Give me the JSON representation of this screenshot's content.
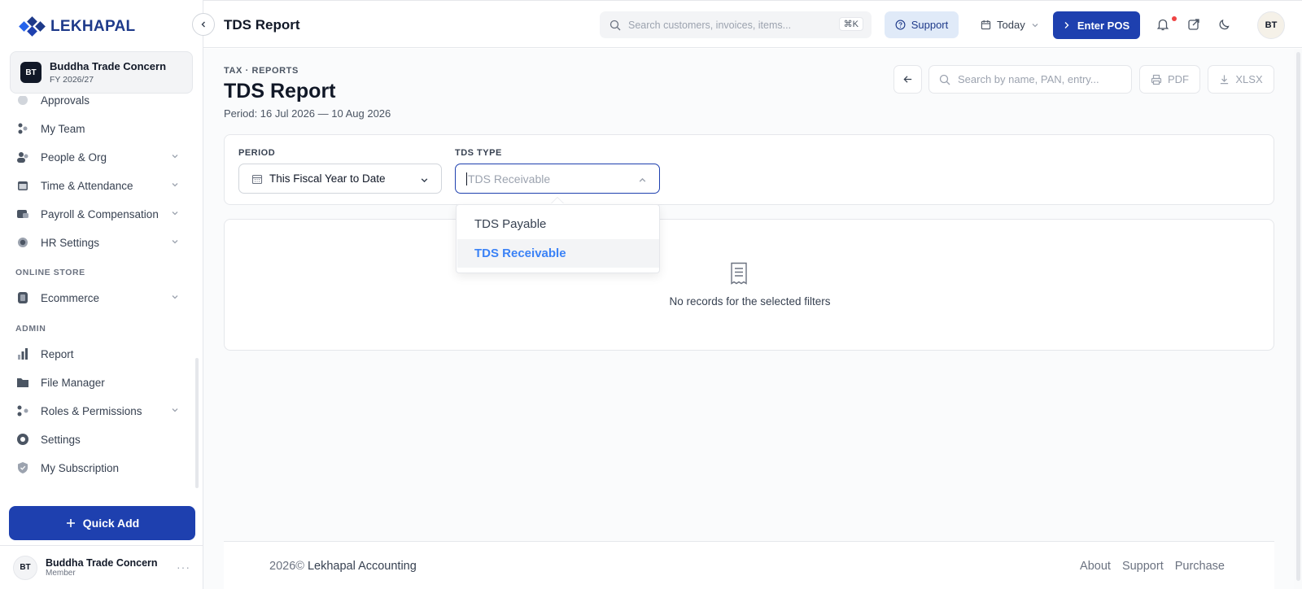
{
  "brand": {
    "name": "LEKHAPAL"
  },
  "org": {
    "initials": "BT",
    "name": "Buddha Trade Concern",
    "fy": "FY 2026/27"
  },
  "sidebar": {
    "items": [
      {
        "label": "Approvals",
        "icon": "approvals-icon"
      },
      {
        "label": "My Team",
        "icon": "team-icon"
      },
      {
        "label": "People & Org",
        "icon": "people-icon",
        "has_children": true
      },
      {
        "label": "Time & Attendance",
        "icon": "calendar-icon",
        "has_children": true
      },
      {
        "label": "Payroll & Compensation",
        "icon": "payroll-icon",
        "has_children": true
      },
      {
        "label": "HR Settings",
        "icon": "gear-icon",
        "has_children": true
      }
    ],
    "section_online_store": "ONLINE STORE",
    "online_store_items": [
      {
        "label": "Ecommerce",
        "icon": "store-icon",
        "has_children": true
      }
    ],
    "section_admin": "ADMIN",
    "admin_items": [
      {
        "label": "Report",
        "icon": "bar-chart-icon"
      },
      {
        "label": "File Manager",
        "icon": "folder-icon"
      },
      {
        "label": "Roles & Permissions",
        "icon": "roles-icon",
        "has_children": true
      },
      {
        "label": "Settings",
        "icon": "settings-icon"
      },
      {
        "label": "My Subscription",
        "icon": "shield-icon"
      }
    ],
    "quick_add_label": "Quick Add"
  },
  "user": {
    "initials": "BT",
    "name": "Buddha Trade Concern",
    "role": "Member"
  },
  "header": {
    "title": "TDS Report",
    "search_placeholder": "Search customers, invoices, items...",
    "search_shortcut": "⌘K",
    "support_label": "Support",
    "date_label": "Today",
    "pos_label": "Enter POS",
    "avatar_initials": "BT"
  },
  "page": {
    "breadcrumb": "TAX · REPORTS",
    "title": "TDS Report",
    "period_text": "Period: 16 Jul 2026 — 10 Aug 2026",
    "search_placeholder": "Search by name, PAN, entry...",
    "pdf_label": "PDF",
    "xlsx_label": "XLSX"
  },
  "filters": {
    "period_label": "PERIOD",
    "period_value": "This Fiscal Year to Date",
    "tds_type_label": "TDS TYPE",
    "tds_type_placeholder": "TDS Receivable",
    "options": [
      "TDS Payable",
      "TDS Receivable"
    ],
    "selected_option": "TDS Receivable"
  },
  "empty_state": {
    "message": "No records for the selected filters"
  },
  "footer": {
    "year": "2026©",
    "company": "Lekhapal Accounting",
    "links": [
      "About",
      "Support",
      "Purchase"
    ]
  },
  "colors": {
    "primary": "#1e40af",
    "accent": "#3b82f6",
    "brand": "#1e3a8a"
  }
}
